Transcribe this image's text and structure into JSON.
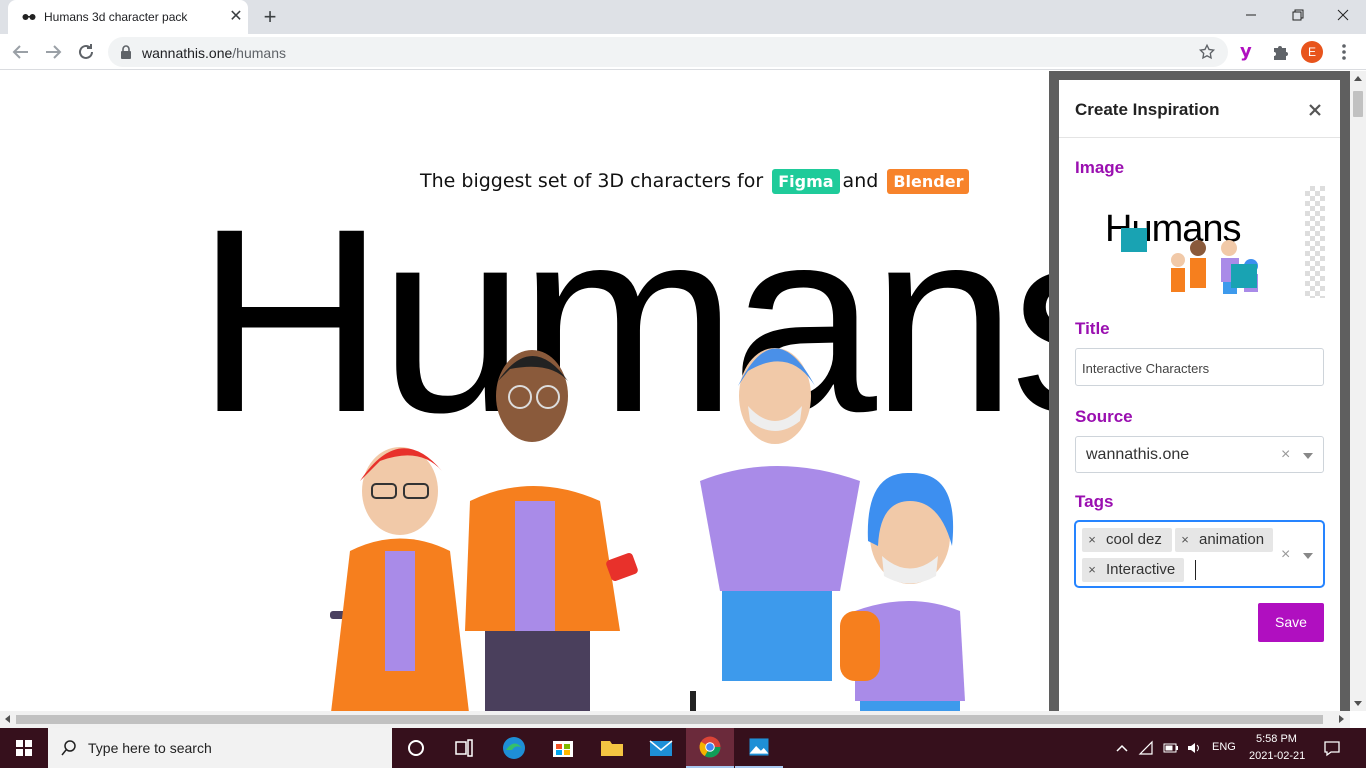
{
  "browser": {
    "tab_title": "Humans 3d character pack",
    "url_host": "wannathis.one",
    "url_path": "/humans",
    "profile_initial": "E",
    "extension_letter": "y"
  },
  "page": {
    "tagline_pre": "The biggest set of 3D characters for",
    "badge_figma": "Figma",
    "tagline_mid": "and",
    "badge_blender": "Blender",
    "hero_title": "Humans"
  },
  "panel": {
    "title": "Create Inspiration",
    "image_label": "Image",
    "title_label": "Title",
    "title_value": "Interactive Characters",
    "source_label": "Source",
    "source_value": "wannathis.one",
    "tags_label": "Tags",
    "tags": [
      "cool dez",
      "animation",
      "Interactive"
    ],
    "save_label": "Save",
    "thumb_title": "Humans"
  },
  "taskbar": {
    "search_placeholder": "Type here to search",
    "language": "ENG",
    "time": "5:58 PM",
    "date": "2021-02-21"
  },
  "colors": {
    "accent": "#b00fc0",
    "figma": "#1fcb9a",
    "blender": "#f7832b",
    "taskbar": "#36101c",
    "focus": "#2684ff"
  }
}
